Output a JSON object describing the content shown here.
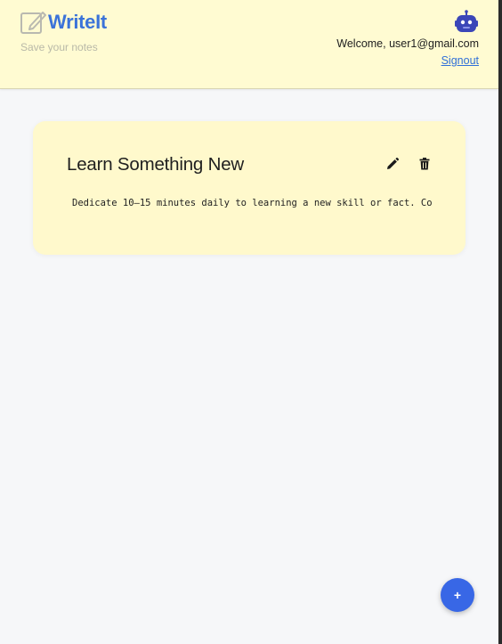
{
  "header": {
    "brand_title": "WriteIt",
    "tagline": "Save your notes",
    "welcome_text": "Welcome, user1@gmail.com",
    "signout_label": "Signout",
    "brand_icon": "pencil-square-icon",
    "avatar_icon": "robot-avatar-icon"
  },
  "notes": [
    {
      "title": "Learn Something New",
      "body": "Dedicate 10–15 minutes daily to learning a new skill or fact. Co",
      "edit_icon": "pencil-icon",
      "delete_icon": "trash-icon"
    }
  ],
  "fab": {
    "label": "+",
    "icon": "plus-icon"
  },
  "colors": {
    "header_bg": "#fffbd2",
    "card_bg": "#fff9cc",
    "brand": "#3b73d9",
    "fab": "#3867e6",
    "link": "#2f6fd8"
  }
}
